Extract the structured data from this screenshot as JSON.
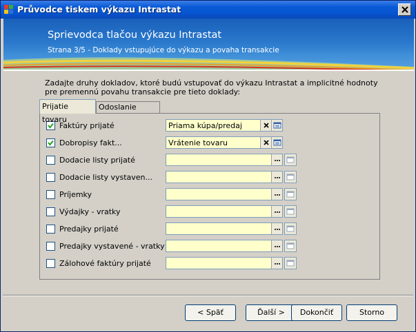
{
  "window": {
    "title": "Průvodce tiskem výkazu Intrastat",
    "colors": {
      "titlebar": "#0654d0",
      "banner": "#2a78cc",
      "field_bg": "#ffffcc",
      "panel": "#d4d0c8"
    }
  },
  "banner": {
    "title": "Sprievodca tlačou výkazu Intrastat",
    "subtitle": "Strana 3/5 - Doklady vstupujúce do výkazu a povaha transakcie"
  },
  "intro": "Zadajte druhy dokladov, ktoré budú vstupovať do výkazu Intrastat a implicitné hodnoty pre premennú povahu transakcie pre tieto doklady:",
  "tabs": [
    {
      "label": "Prijatie tovaru",
      "active": true
    },
    {
      "label": "Odoslanie tovaru",
      "active": false
    }
  ],
  "rows": [
    {
      "label": "Faktúry prijaté",
      "checked": true,
      "value": "Priama kúpa/predaj",
      "icon": "clear-icon"
    },
    {
      "label": "Dobropisy fakt...",
      "checked": true,
      "value": "Vrátenie tovaru",
      "icon": "clear-icon"
    },
    {
      "label": "Dodacie listy prijaté",
      "checked": false,
      "value": "",
      "icon": "ellipsis-icon"
    },
    {
      "label": "Dodacie listy vystaven...",
      "checked": false,
      "value": "",
      "icon": "ellipsis-icon"
    },
    {
      "label": "Príjemky",
      "checked": false,
      "value": "",
      "icon": "ellipsis-icon"
    },
    {
      "label": "Výdajky - vratky",
      "checked": false,
      "value": "",
      "icon": "ellipsis-icon"
    },
    {
      "label": "Predajky prijaté",
      "checked": false,
      "value": "",
      "icon": "ellipsis-icon"
    },
    {
      "label": "Predajky vystavené - vratky",
      "checked": false,
      "value": "",
      "icon": "ellipsis-icon"
    },
    {
      "label": "Zálohové faktúry prijaté",
      "checked": false,
      "value": "",
      "icon": "ellipsis-icon"
    }
  ],
  "buttons": {
    "back": "< Späť",
    "next": "Ďalší >",
    "finish": "Dokončiť",
    "cancel": "Storno"
  }
}
